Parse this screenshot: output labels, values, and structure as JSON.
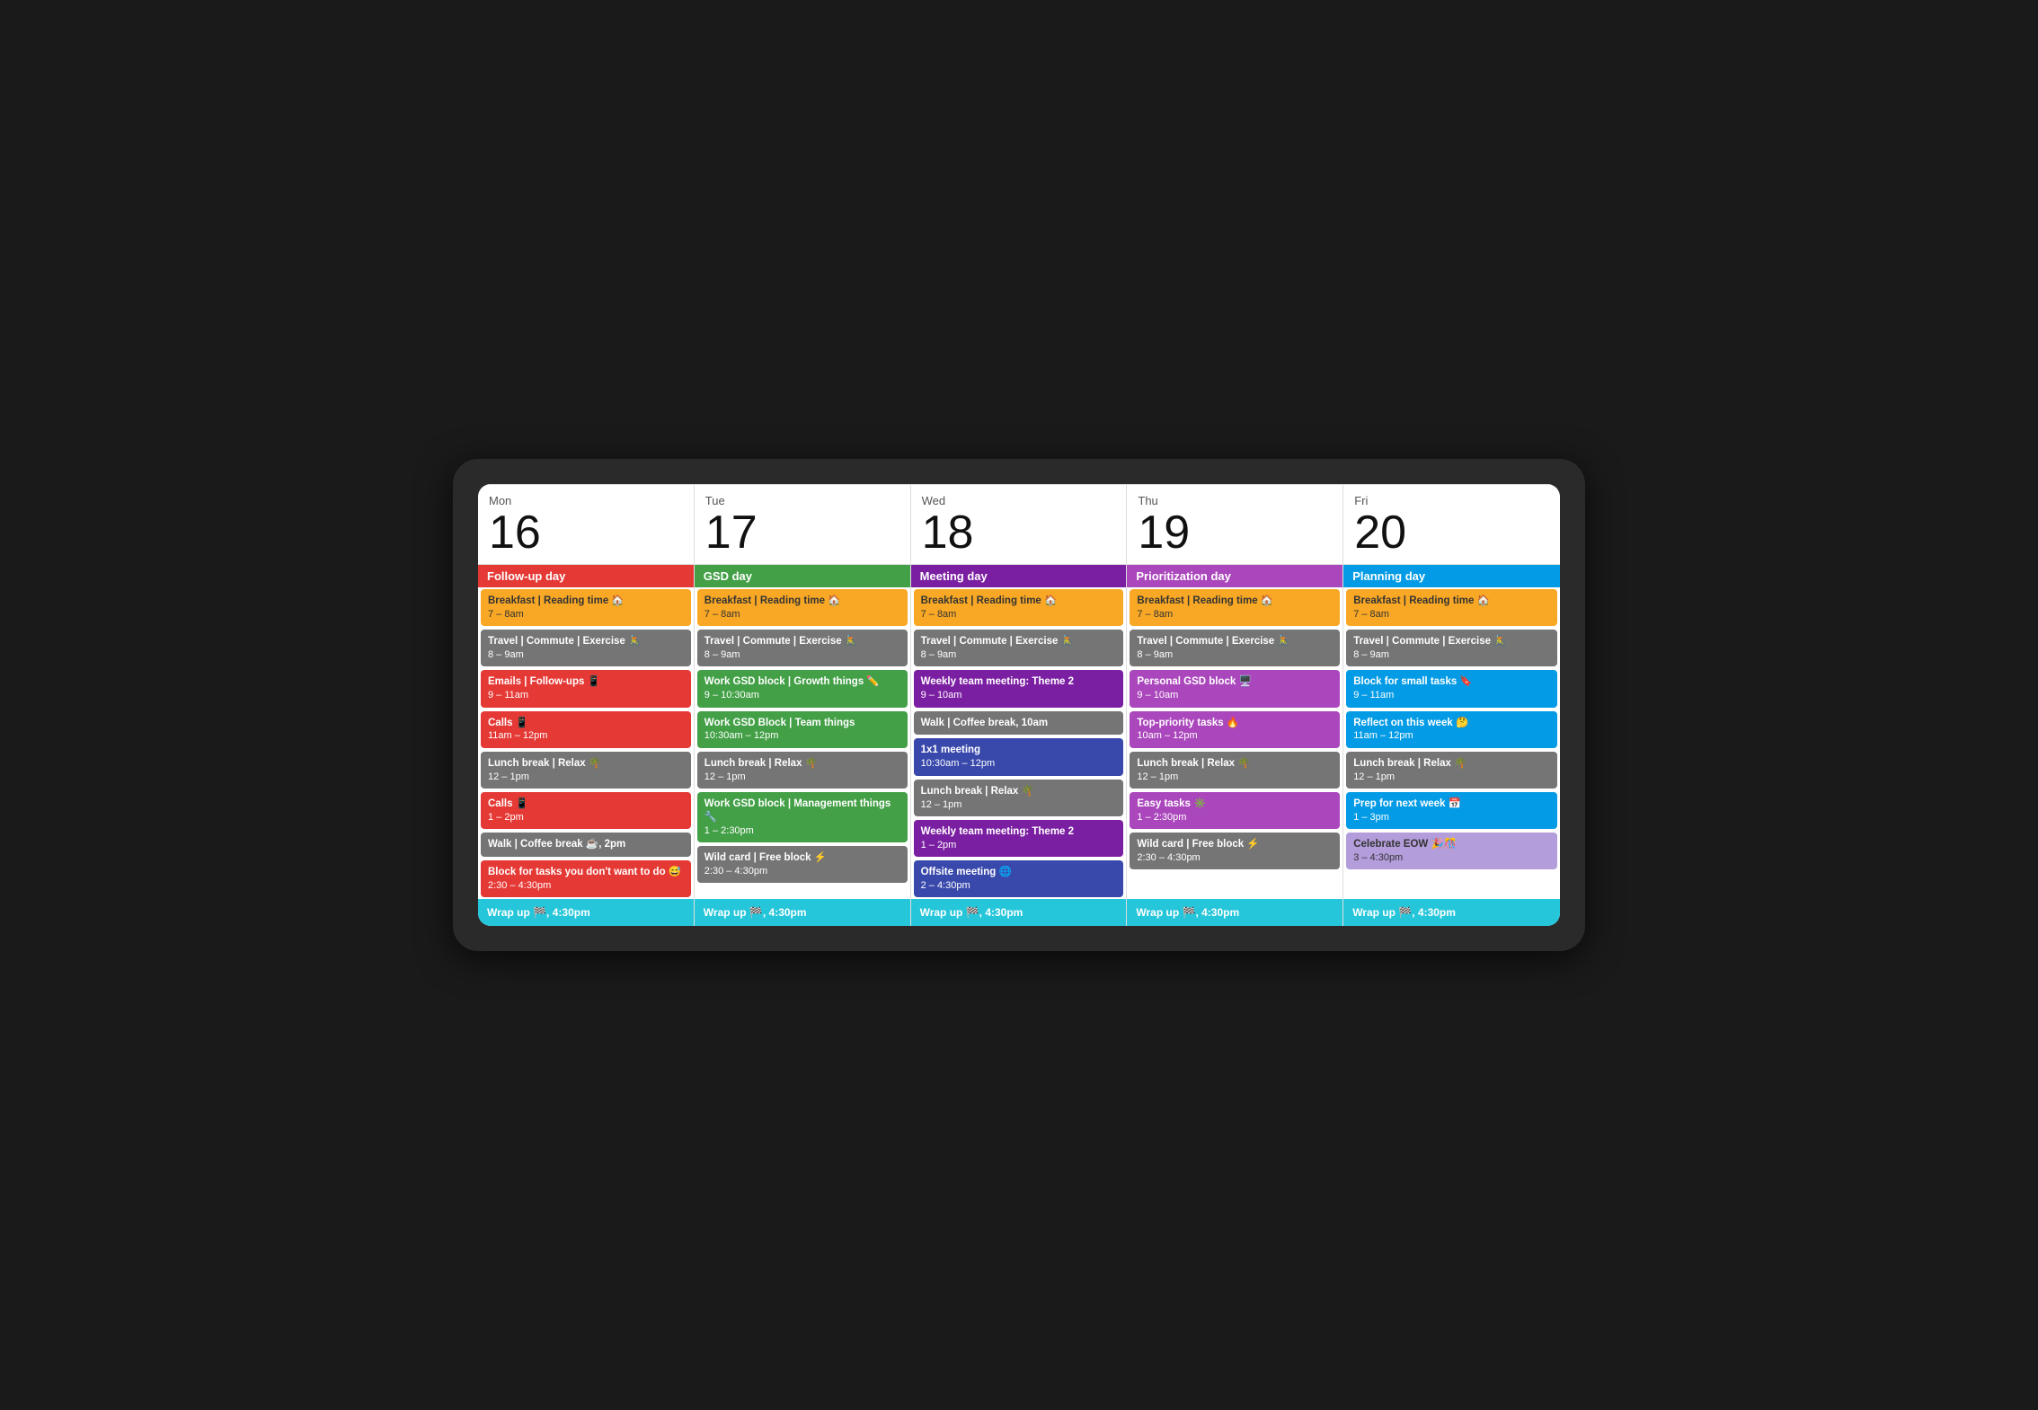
{
  "calendar": {
    "days": [
      {
        "name": "Mon",
        "number": "16",
        "theme": "Follow-up day",
        "theme_color": "#e53935",
        "events": [
          {
            "label": "Breakfast | Reading time 🏠",
            "time": "7 – 8am",
            "color": "#f9a825",
            "text_color": "#333"
          },
          {
            "label": "Travel | Commute | Exercise 🚴",
            "time": "8 – 9am",
            "color": "#757575",
            "text_color": "#fff"
          },
          {
            "label": "Emails | Follow-ups 📱",
            "time": "9 – 11am",
            "color": "#e53935",
            "text_color": "#fff"
          },
          {
            "label": "Calls 📱",
            "time": "11am – 12pm",
            "color": "#e53935",
            "text_color": "#fff"
          },
          {
            "label": "Lunch break | Relax 🌴",
            "time": "12 – 1pm",
            "color": "#757575",
            "text_color": "#fff"
          },
          {
            "label": "Calls 📱",
            "time": "1 – 2pm",
            "color": "#e53935",
            "text_color": "#fff"
          },
          {
            "label": "Walk | Coffee break ☕, 2pm",
            "time": "",
            "color": "#757575",
            "text_color": "#fff"
          },
          {
            "label": "Block for tasks you don't want to do 😅",
            "time": "2:30 – 4:30pm",
            "color": "#e53935",
            "text_color": "#fff"
          }
        ],
        "wrapup": "Wrap up 🏁, 4:30pm",
        "wrapup_color": "#26c6da"
      },
      {
        "name": "Tue",
        "number": "17",
        "theme": "GSD day",
        "theme_color": "#43a047",
        "events": [
          {
            "label": "Breakfast | Reading time 🏠",
            "time": "7 – 8am",
            "color": "#f9a825",
            "text_color": "#333"
          },
          {
            "label": "Travel | Commute | Exercise 🚴",
            "time": "8 – 9am",
            "color": "#757575",
            "text_color": "#fff"
          },
          {
            "label": "Work GSD block | Growth things ✏️",
            "time": "9 – 10:30am",
            "color": "#43a047",
            "text_color": "#fff"
          },
          {
            "label": "Work GSD Block | Team things",
            "time": "10:30am – 12pm",
            "color": "#43a047",
            "text_color": "#fff"
          },
          {
            "label": "Lunch break | Relax 🌴",
            "time": "12 – 1pm",
            "color": "#757575",
            "text_color": "#fff"
          },
          {
            "label": "Work GSD block | Management things 🔧",
            "time": "1 – 2:30pm",
            "color": "#43a047",
            "text_color": "#fff"
          },
          {
            "label": "Wild card | Free block ⚡",
            "time": "2:30 – 4:30pm",
            "color": "#757575",
            "text_color": "#fff"
          }
        ],
        "wrapup": "Wrap up 🏁, 4:30pm",
        "wrapup_color": "#26c6da"
      },
      {
        "name": "Wed",
        "number": "18",
        "theme": "Meeting day",
        "theme_color": "#7b1fa2",
        "events": [
          {
            "label": "Breakfast | Reading time 🏠",
            "time": "7 – 8am",
            "color": "#f9a825",
            "text_color": "#333"
          },
          {
            "label": "Travel | Commute | Exercise 🚴",
            "time": "8 – 9am",
            "color": "#757575",
            "text_color": "#fff"
          },
          {
            "label": "Weekly team meeting: Theme 2",
            "time": "9 – 10am",
            "color": "#7b1fa2",
            "text_color": "#fff"
          },
          {
            "label": "Walk | Coffee break, 10am",
            "time": "",
            "color": "#757575",
            "text_color": "#fff"
          },
          {
            "label": "1x1 meeting",
            "time": "10:30am – 12pm",
            "color": "#3949ab",
            "text_color": "#fff"
          },
          {
            "label": "Lunch break | Relax 🌴",
            "time": "12 – 1pm",
            "color": "#757575",
            "text_color": "#fff"
          },
          {
            "label": "Weekly team meeting: Theme 2",
            "time": "1 – 2pm",
            "color": "#7b1fa2",
            "text_color": "#fff"
          },
          {
            "label": "Offsite meeting 🌐",
            "time": "2 – 4:30pm",
            "color": "#3949ab",
            "text_color": "#fff"
          }
        ],
        "wrapup": "Wrap up 🏁, 4:30pm",
        "wrapup_color": "#26c6da"
      },
      {
        "name": "Thu",
        "number": "19",
        "theme": "Prioritization day",
        "theme_color": "#ab47bc",
        "events": [
          {
            "label": "Breakfast | Reading time 🏠",
            "time": "7 – 8am",
            "color": "#f9a825",
            "text_color": "#333"
          },
          {
            "label": "Travel | Commute | Exercise 🚴",
            "time": "8 – 9am",
            "color": "#757575",
            "text_color": "#fff"
          },
          {
            "label": "Personal GSD block 🖥️",
            "time": "9 – 10am",
            "color": "#ab47bc",
            "text_color": "#fff"
          },
          {
            "label": "Top-priority tasks 🔥",
            "time": "10am – 12pm",
            "color": "#ab47bc",
            "text_color": "#fff"
          },
          {
            "label": "Lunch break | Relax 🌴",
            "time": "12 – 1pm",
            "color": "#757575",
            "text_color": "#fff"
          },
          {
            "label": "Easy tasks ✳️",
            "time": "1 – 2:30pm",
            "color": "#ab47bc",
            "text_color": "#fff"
          },
          {
            "label": "Wild card | Free block ⚡",
            "time": "2:30 – 4:30pm",
            "color": "#757575",
            "text_color": "#fff"
          }
        ],
        "wrapup": "Wrap up 🏁, 4:30pm",
        "wrapup_color": "#26c6da"
      },
      {
        "name": "Fri",
        "number": "20",
        "theme": "Planning day",
        "theme_color": "#039be5",
        "events": [
          {
            "label": "Breakfast | Reading time 🏠",
            "time": "7 – 8am",
            "color": "#f9a825",
            "text_color": "#333"
          },
          {
            "label": "Travel | Commute | Exercise 🚴",
            "time": "8 – 9am",
            "color": "#757575",
            "text_color": "#fff"
          },
          {
            "label": "Block for small tasks 🔖",
            "time": "9 – 11am",
            "color": "#039be5",
            "text_color": "#fff"
          },
          {
            "label": "Reflect on this week 🤔",
            "time": "11am – 12pm",
            "color": "#039be5",
            "text_color": "#fff"
          },
          {
            "label": "Lunch break | Relax 🌴",
            "time": "12 – 1pm",
            "color": "#757575",
            "text_color": "#fff"
          },
          {
            "label": "Prep for next week 📅",
            "time": "1 – 3pm",
            "color": "#039be5",
            "text_color": "#fff"
          },
          {
            "label": "Celebrate EOW 🎉🎊",
            "time": "3 – 4:30pm",
            "color": "#b39ddb",
            "text_color": "#333"
          }
        ],
        "wrapup": "Wrap up 🏁, 4:30pm",
        "wrapup_color": "#26c6da"
      }
    ]
  }
}
